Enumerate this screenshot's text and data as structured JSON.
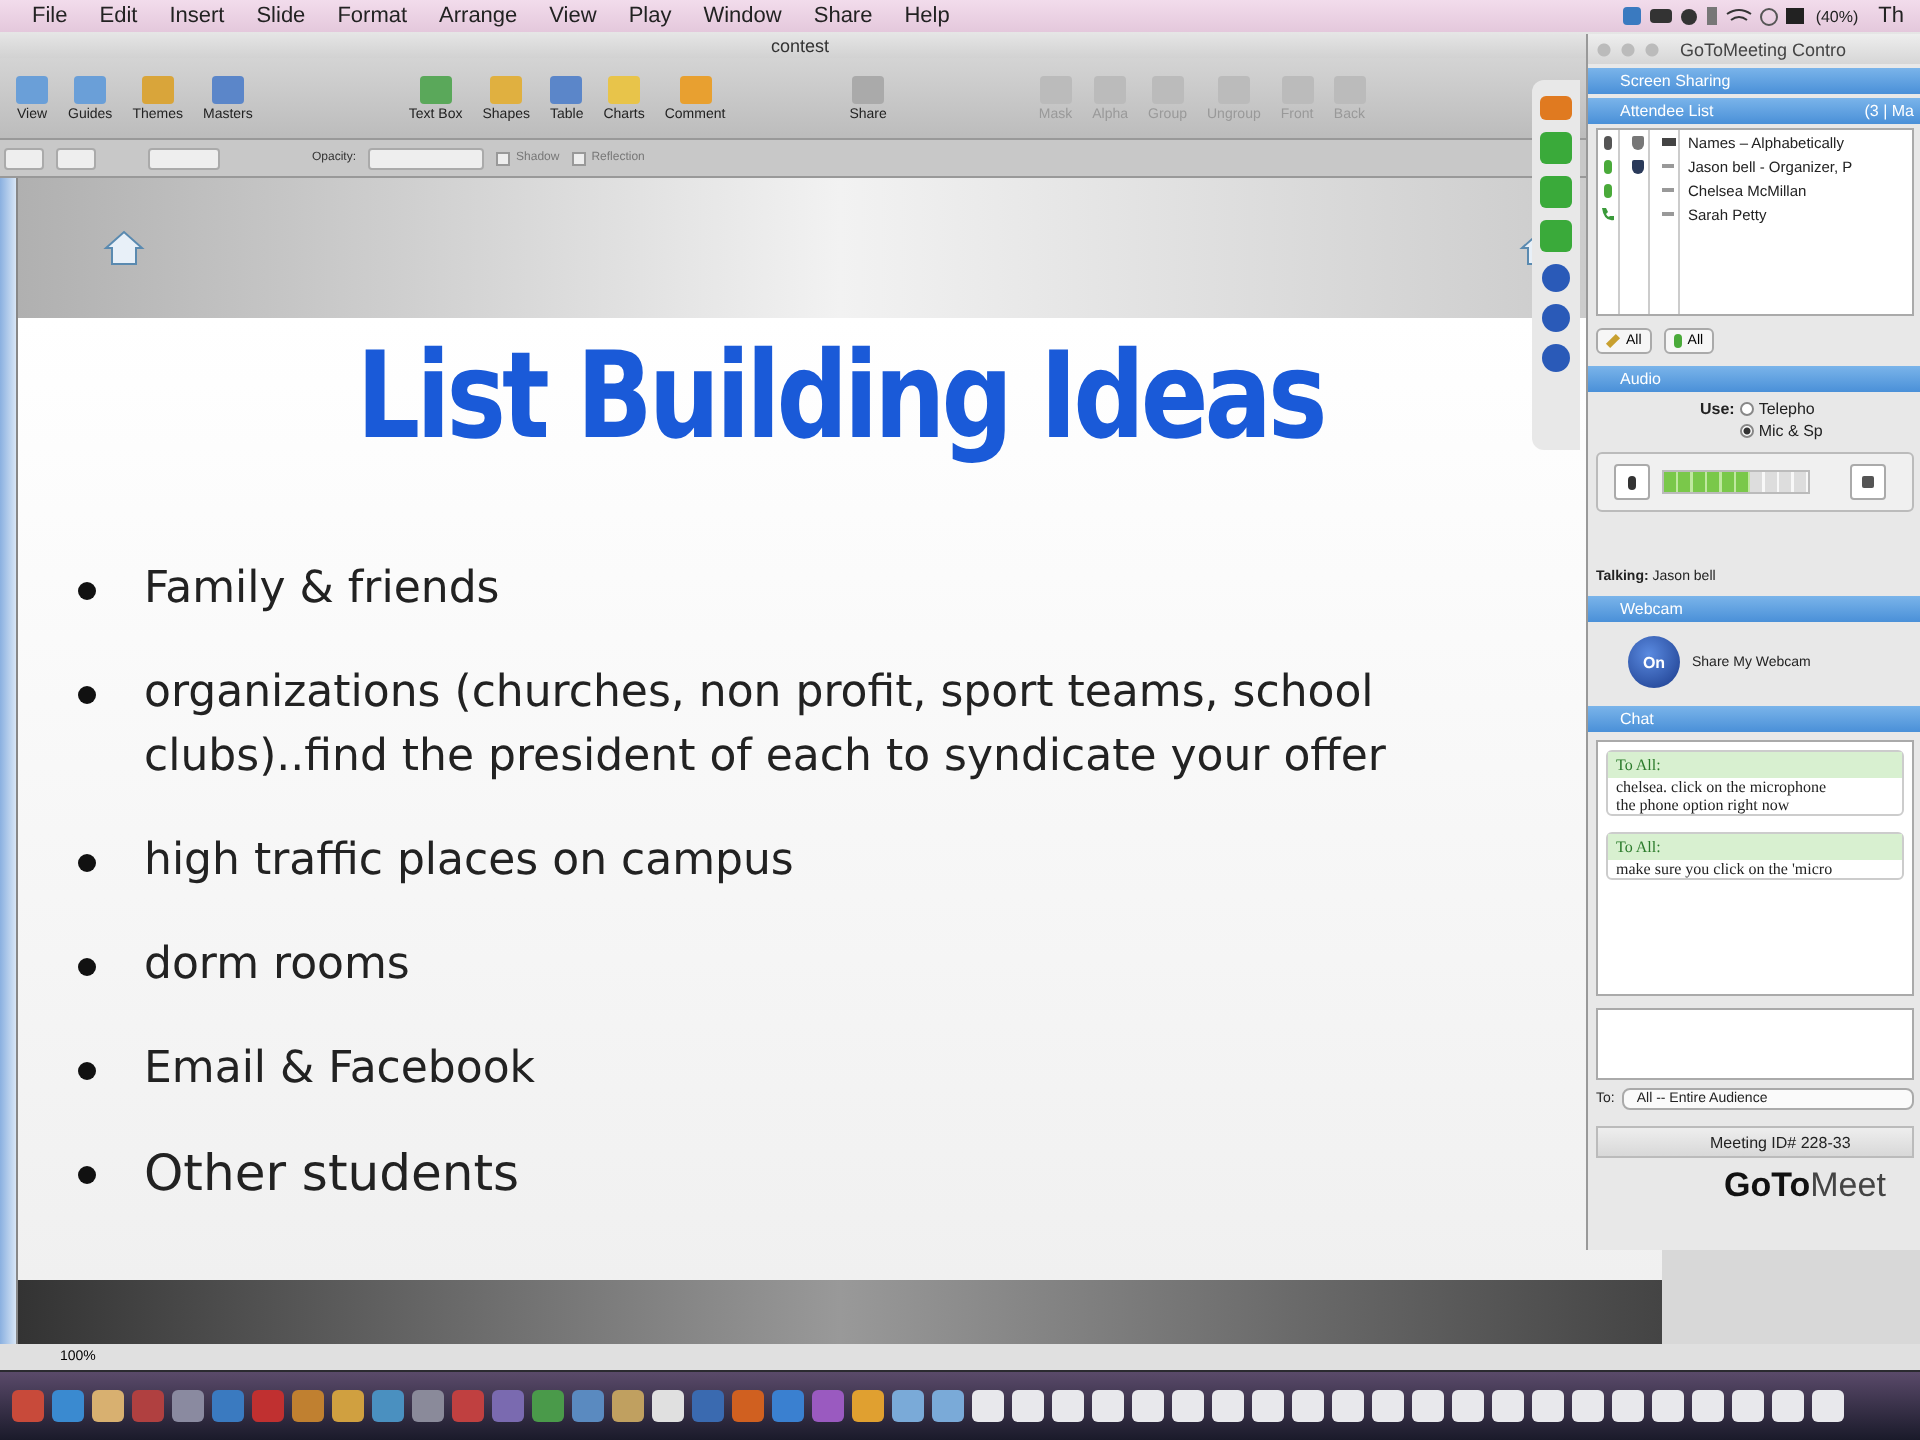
{
  "menu_bar": {
    "items": [
      "File",
      "Edit",
      "Insert",
      "Slide",
      "Format",
      "Arrange",
      "View",
      "Play",
      "Window",
      "Share",
      "Help"
    ],
    "battery": "(40%)",
    "clock": "Th"
  },
  "keynote": {
    "title": "contest",
    "toolbar_groups": [
      [
        {
          "label": "View",
          "disabled": false
        },
        {
          "label": "Guides",
          "disabled": false
        },
        {
          "label": "Themes",
          "disabled": false
        },
        {
          "label": "Masters",
          "disabled": false
        }
      ],
      [
        {
          "label": "Text Box",
          "disabled": false
        },
        {
          "label": "Shapes",
          "disabled": false
        },
        {
          "label": "Table",
          "disabled": false
        },
        {
          "label": "Charts",
          "disabled": false
        },
        {
          "label": "Comment",
          "disabled": false
        }
      ],
      [
        {
          "label": "Share",
          "disabled": false
        }
      ],
      [
        {
          "label": "Mask",
          "disabled": true
        },
        {
          "label": "Alpha",
          "disabled": true
        },
        {
          "label": "Group",
          "disabled": true
        },
        {
          "label": "Ungroup",
          "disabled": true
        },
        {
          "label": "Front",
          "disabled": true
        },
        {
          "label": "Back",
          "disabled": true
        }
      ]
    ],
    "format_bar": {
      "opacity_label": "Opacity:",
      "checks": [
        {
          "label": "Shadow",
          "checked": false
        },
        {
          "label": "Reflection",
          "checked": false
        }
      ]
    },
    "slide": {
      "title": "List Building Ideas",
      "bullets": [
        {
          "text": "Family & friends"
        },
        {
          "text": "organizations (churches, non profit, sport teams, school clubs)..find the president of each to syndicate  your offer"
        },
        {
          "text": "high traffic places on campus"
        },
        {
          "text": "dorm rooms"
        },
        {
          "text": "Email & Facebook"
        },
        {
          "text": "Other students"
        }
      ]
    },
    "zoom": "100%"
  },
  "gotomeeting": {
    "title": "GoToMeeting Contro",
    "sections": {
      "screen_sharing": "Screen Sharing",
      "attendee_list": "Attendee List",
      "attendee_count": "(3 | Ma",
      "audio": "Audio",
      "webcam": "Webcam",
      "chat": "Chat"
    },
    "attendee_header": "Names – Alphabetically",
    "attendees": [
      {
        "name": "Jason  bell - Organizer, P",
        "kind": "mic",
        "organizer": true
      },
      {
        "name": "Chelsea McMillan",
        "kind": "mic",
        "organizer": false
      },
      {
        "name": "Sarah Petty",
        "kind": "phone",
        "organizer": false
      }
    ],
    "all_buttons": [
      "All",
      "All"
    ],
    "audio": {
      "use_label": "Use:",
      "options": [
        {
          "label": "Telepho",
          "selected": false
        },
        {
          "label": "Mic & Sp",
          "selected": true
        }
      ],
      "level": 0.6,
      "talking_label": "Talking:",
      "talking": "Jason  bell"
    },
    "webcam": {
      "button": "On",
      "label": "Share My Webcam"
    },
    "chat": {
      "messages": [
        {
          "to": "To All:",
          "lines": [
            "chelsea. click on the microphone",
            "the phone option right now"
          ]
        },
        {
          "to": "To All:",
          "lines": [
            "make sure you click on the 'micro"
          ]
        }
      ],
      "to_label": "To:",
      "to_value": "All -- Entire Audience"
    },
    "meeting_id": "Meeting ID# 228-33",
    "logo": {
      "bold": "GoTo",
      "light": "Meet"
    }
  }
}
